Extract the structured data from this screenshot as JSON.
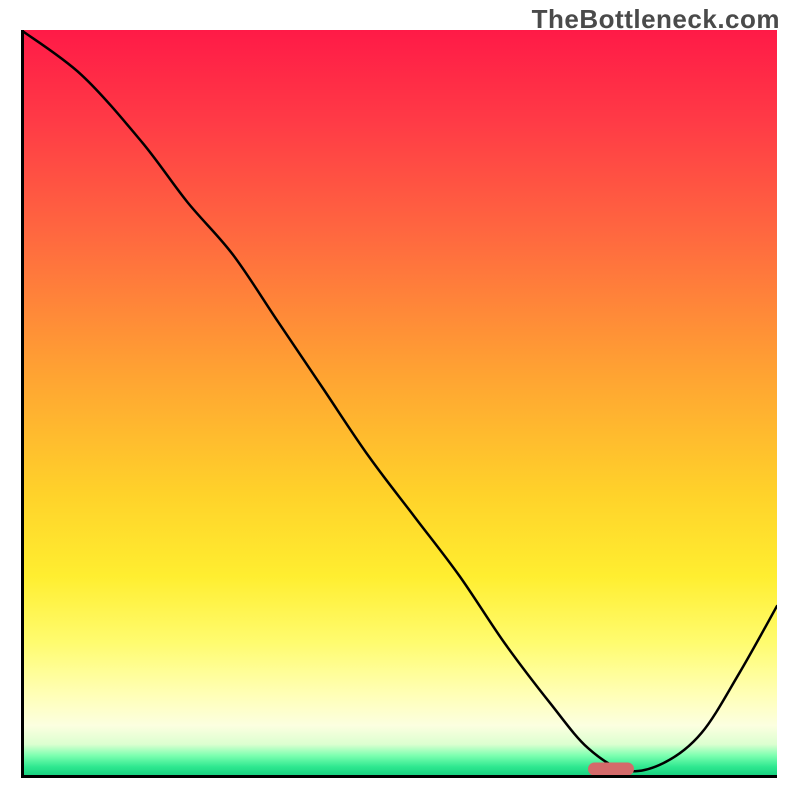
{
  "watermark": "TheBottleneck.com",
  "chart_data": {
    "type": "line",
    "title": "",
    "xlabel": "",
    "ylabel": "",
    "xlim": [
      0,
      100
    ],
    "ylim": [
      0,
      100
    ],
    "x": [
      0,
      8,
      16,
      22,
      28,
      34,
      40,
      46,
      52,
      58,
      64,
      70,
      75,
      80,
      85,
      90,
      95,
      100
    ],
    "values": [
      100,
      94,
      85,
      77,
      70,
      61,
      52,
      43,
      35,
      27,
      18,
      10,
      4,
      1,
      2,
      6,
      14,
      23
    ],
    "marker": {
      "x": 78,
      "y": 1.2
    },
    "background_gradient": {
      "top": "#ff1a47",
      "mid1": "#ffa033",
      "mid2": "#ffee30",
      "bottom": "#10c97a"
    },
    "annotations": []
  }
}
